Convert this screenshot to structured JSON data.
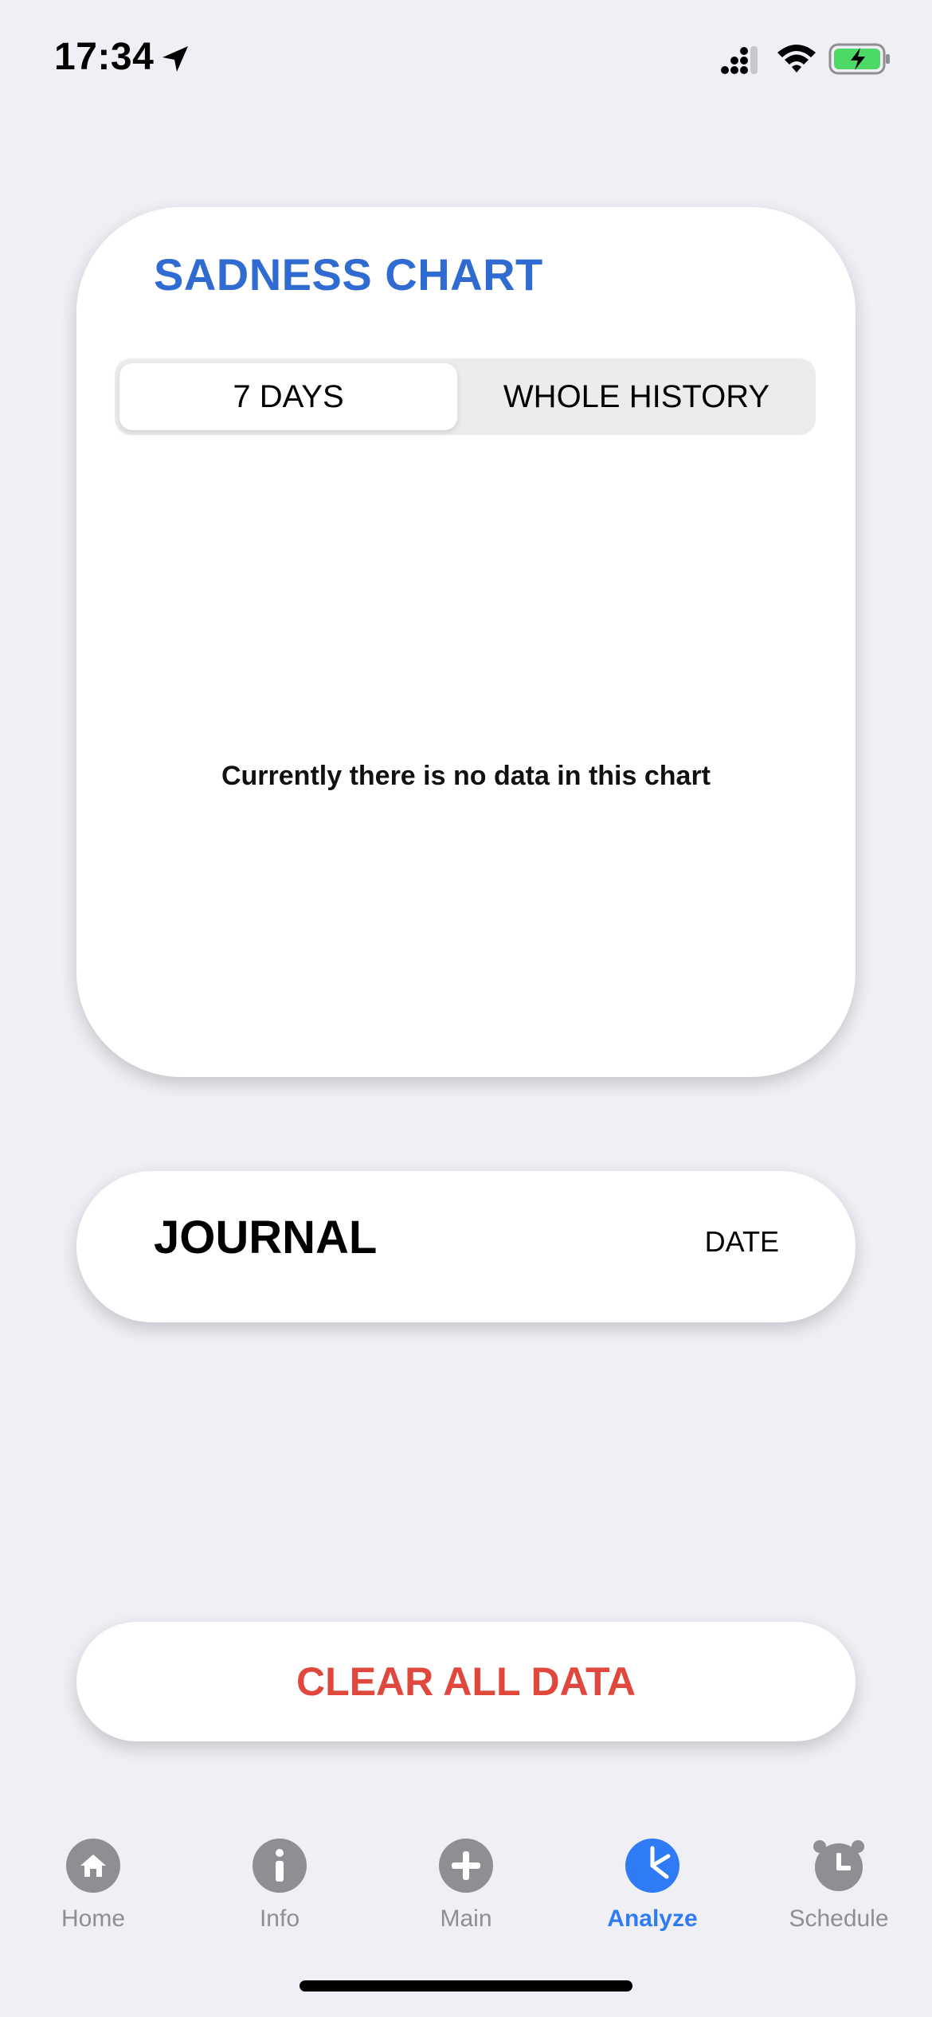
{
  "status_bar": {
    "time": "17:34"
  },
  "chart_card": {
    "title": "SADNESS CHART",
    "segments": {
      "selected": "7 DAYS",
      "other": "WHOLE HISTORY"
    },
    "empty_message": "Currently there is no data in this chart"
  },
  "journal_card": {
    "title": "JOURNAL",
    "date_label": "DATE"
  },
  "clear_button": {
    "label": "CLEAR ALL DATA"
  },
  "tab_bar": {
    "items": [
      {
        "label": "Home",
        "icon": "house-icon"
      },
      {
        "label": "Info",
        "icon": "info-icon"
      },
      {
        "label": "Main",
        "icon": "plus-icon"
      },
      {
        "label": "Analyze",
        "icon": "pie-chart-icon",
        "active": true
      },
      {
        "label": "Schedule",
        "icon": "alarm-clock-icon"
      }
    ]
  },
  "colors": {
    "accent": "#2f7bf5",
    "title_blue": "#2f6bd1",
    "destructive": "#e0483e",
    "inactive_tab": "#8e8e93",
    "background": "#f0eff5"
  }
}
